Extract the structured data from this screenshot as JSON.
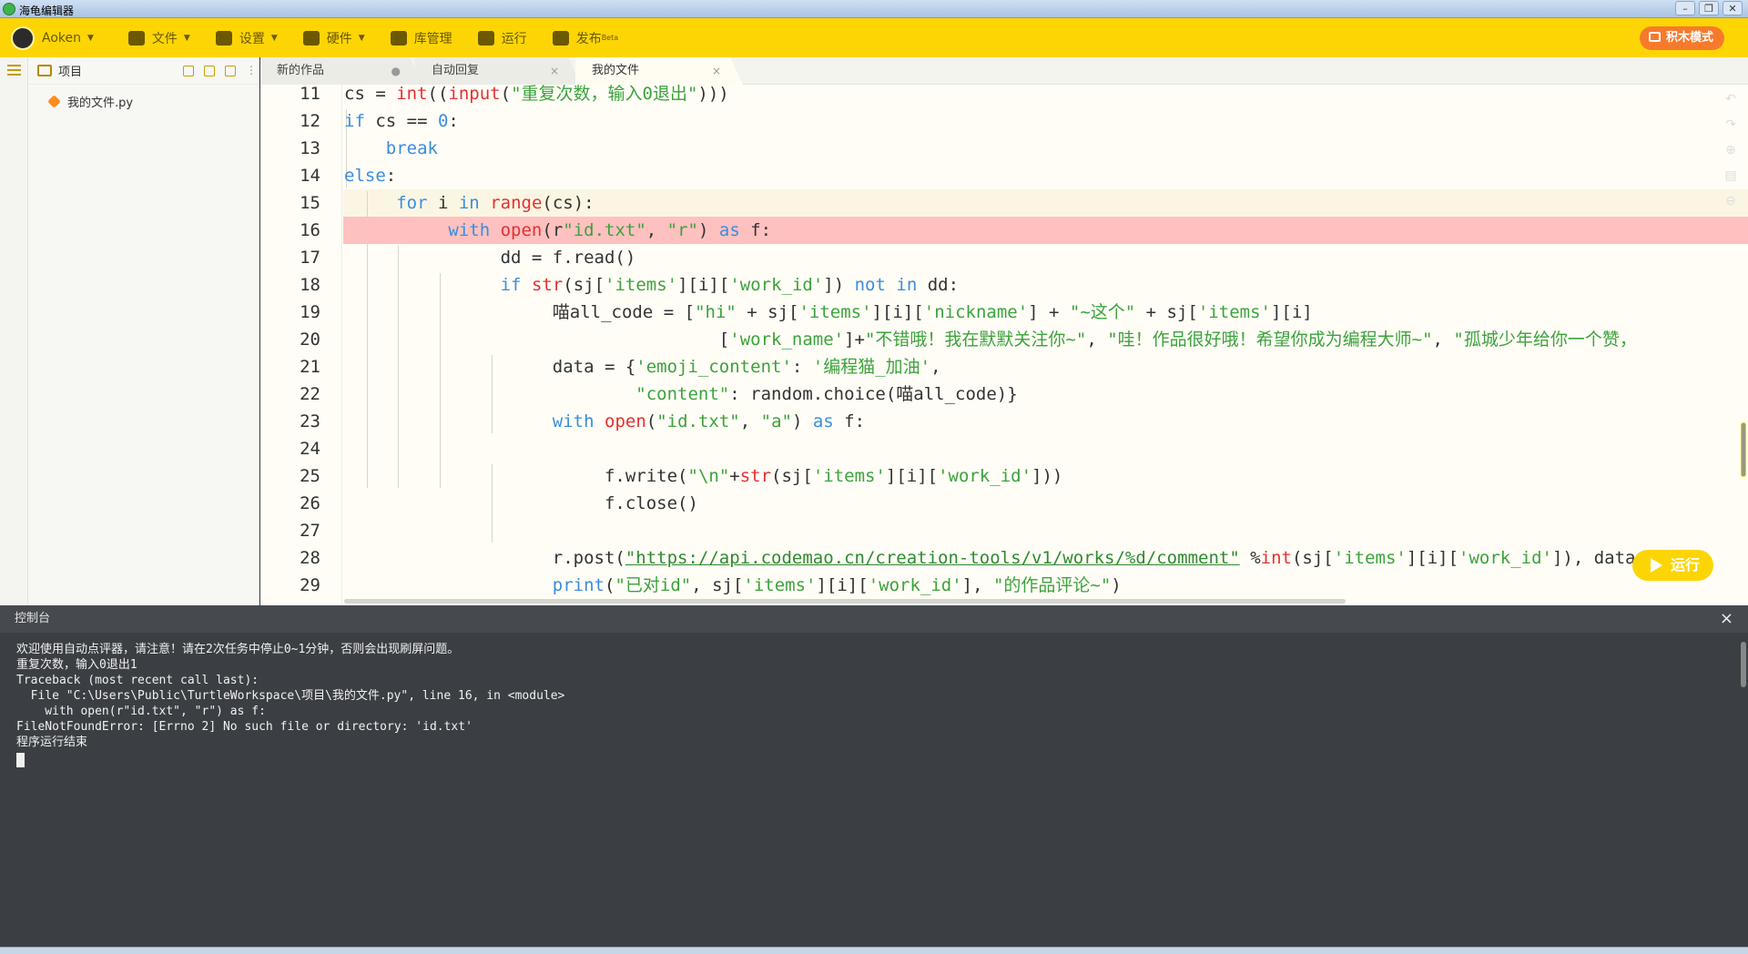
{
  "window": {
    "title": "海龟编辑器"
  },
  "menu": {
    "user": "Aoken",
    "items": [
      {
        "label": "文件",
        "caret": true
      },
      {
        "label": "设置",
        "caret": true
      },
      {
        "label": "硬件",
        "caret": true
      },
      {
        "label": "库管理",
        "caret": false
      },
      {
        "label": "运行",
        "caret": false
      },
      {
        "label": "发布",
        "caret": false
      }
    ],
    "publish_badge": "Beta",
    "block_mode": "积木模式"
  },
  "project": {
    "title": "项目",
    "files": [
      "我的文件.py"
    ]
  },
  "tabs": [
    {
      "label": "新的作品",
      "close": "●"
    },
    {
      "label": "自动回复",
      "close": "×"
    },
    {
      "label": "我的文件",
      "close": "×"
    }
  ],
  "editor": {
    "lines": [
      {
        "n": "11",
        "code": [
          [
            "cs = ",
            ""
          ],
          [
            "int",
            "fn"
          ],
          [
            "((",
            ""
          ],
          [
            "input",
            "fn"
          ],
          [
            "(",
            ""
          ],
          [
            "\"重复次数，输入0退出\"",
            "st"
          ],
          [
            ")))",
            ""
          ]
        ]
      },
      {
        "n": "12",
        "code": [
          [
            "if",
            "kw"
          ],
          [
            " cs == ",
            ""
          ],
          [
            "0",
            "nm"
          ],
          [
            ":",
            ""
          ]
        ]
      },
      {
        "n": "13",
        "code": [
          [
            "    ",
            ""
          ],
          [
            "break",
            "kw"
          ]
        ]
      },
      {
        "n": "14",
        "code": [
          [
            "else",
            "kw"
          ],
          [
            ":",
            ""
          ]
        ]
      },
      {
        "n": "15",
        "code": [
          [
            "     ",
            ""
          ],
          [
            "for",
            "kw"
          ],
          [
            " i ",
            ""
          ],
          [
            "in",
            "kw"
          ],
          [
            " ",
            ""
          ],
          [
            "range",
            "fn"
          ],
          [
            "(cs):",
            ""
          ]
        ]
      },
      {
        "n": "16",
        "code": [
          [
            "          ",
            ""
          ],
          [
            "with",
            "kw"
          ],
          [
            " ",
            ""
          ],
          [
            "open",
            "fn"
          ],
          [
            "(r",
            ""
          ],
          [
            "\"id.txt\"",
            "st"
          ],
          [
            ", ",
            ""
          ],
          [
            "\"r\"",
            "st"
          ],
          [
            ") ",
            ""
          ],
          [
            "as",
            "kw"
          ],
          [
            " f:",
            ""
          ]
        ]
      },
      {
        "n": "17",
        "code": [
          [
            "               dd = f.read()",
            ""
          ]
        ]
      },
      {
        "n": "18",
        "code": [
          [
            "               ",
            ""
          ],
          [
            "if",
            "kw"
          ],
          [
            " ",
            ""
          ],
          [
            "str",
            "fn"
          ],
          [
            "(sj[",
            ""
          ],
          [
            "'items'",
            "st"
          ],
          [
            "][i][",
            ""
          ],
          [
            "'work_id'",
            "st"
          ],
          [
            "]) ",
            ""
          ],
          [
            "not",
            "kw"
          ],
          [
            " ",
            ""
          ],
          [
            "in",
            "kw"
          ],
          [
            " dd:",
            ""
          ]
        ]
      },
      {
        "n": "19",
        "code": [
          [
            "                    喵all_code = [",
            ""
          ],
          [
            "\"hi\"",
            "st"
          ],
          [
            " + sj[",
            ""
          ],
          [
            "'items'",
            "st"
          ],
          [
            "][i][",
            ""
          ],
          [
            "'nickname'",
            "st"
          ],
          [
            "] + ",
            ""
          ],
          [
            "\"~这个\"",
            "st"
          ],
          [
            " + sj[",
            ""
          ],
          [
            "'items'",
            "st"
          ],
          [
            "][i]",
            ""
          ]
        ]
      },
      {
        "n": "20",
        "code": [
          [
            "                                    [",
            ""
          ],
          [
            "'work_name'",
            "st"
          ],
          [
            "]+",
            ""
          ],
          [
            "\"不错哦！我在默默关注你~\"",
            "st"
          ],
          [
            ", ",
            ""
          ],
          [
            "\"哇！作品很好哦！希望你成为编程大师~\"",
            "st"
          ],
          [
            ", ",
            ""
          ],
          [
            "\"孤城少年给你一个赞，",
            "st"
          ]
        ]
      },
      {
        "n": "21",
        "code": [
          [
            "                    data = {",
            ""
          ],
          [
            "'emoji_content'",
            "st"
          ],
          [
            ": ",
            ""
          ],
          [
            "'编程猫_加油'",
            "st"
          ],
          [
            ",",
            ""
          ]
        ]
      },
      {
        "n": "22",
        "code": [
          [
            "                            ",
            ""
          ],
          [
            "\"content\"",
            "st"
          ],
          [
            ": random.choice(喵all_code)}",
            ""
          ]
        ]
      },
      {
        "n": "23",
        "code": [
          [
            "                    ",
            ""
          ],
          [
            "with",
            "kw"
          ],
          [
            " ",
            ""
          ],
          [
            "open",
            "fn"
          ],
          [
            "(",
            ""
          ],
          [
            "\"id.txt\"",
            "st"
          ],
          [
            ", ",
            ""
          ],
          [
            "\"a\"",
            "st"
          ],
          [
            ") ",
            ""
          ],
          [
            "as",
            "kw"
          ],
          [
            " f:",
            ""
          ]
        ]
      },
      {
        "n": "24",
        "code": [
          [
            "",
            ""
          ]
        ]
      },
      {
        "n": "25",
        "code": [
          [
            "                         f.write(",
            ""
          ],
          [
            "\"\\n\"",
            "st"
          ],
          [
            "+",
            ""
          ],
          [
            "str",
            "fn"
          ],
          [
            "(sj[",
            ""
          ],
          [
            "'items'",
            "st"
          ],
          [
            "][i][",
            ""
          ],
          [
            "'work_id'",
            "st"
          ],
          [
            "]))",
            ""
          ]
        ]
      },
      {
        "n": "26",
        "code": [
          [
            "                         f.close()",
            ""
          ]
        ]
      },
      {
        "n": "27",
        "code": [
          [
            "",
            ""
          ]
        ]
      },
      {
        "n": "28",
        "code": [
          [
            "                    r.post(",
            ""
          ],
          [
            "\"https://api.codemao.cn/creation-tools/v1/works/%d/comment\"",
            "ur"
          ],
          [
            " %",
            ""
          ],
          [
            "int",
            "fn"
          ],
          [
            "(sj[",
            ""
          ],
          [
            "'items'",
            "st"
          ],
          [
            "][i][",
            ""
          ],
          [
            "'work_id'",
            "st"
          ],
          [
            "]), data=dat",
            ""
          ]
        ]
      },
      {
        "n": "29",
        "code": [
          [
            "                    ",
            ""
          ],
          [
            "print",
            "kw"
          ],
          [
            "(",
            ""
          ],
          [
            "\"已对id\"",
            "st"
          ],
          [
            ", sj[",
            ""
          ],
          [
            "'items'",
            "st"
          ],
          [
            "][i][",
            ""
          ],
          [
            "'work_id'",
            "st"
          ],
          [
            "], ",
            ""
          ],
          [
            "\"的作品评论~\"",
            "st"
          ],
          [
            ")",
            ""
          ]
        ]
      }
    ],
    "run_button": "运行"
  },
  "console": {
    "title": "控制台",
    "close": "×",
    "lines": [
      "欢迎使用自动点评器，请注意！请在2次任务中停止0~1分钟，否则会出现刷屏问题。",
      "重复次数，输入0退出1",
      "Traceback (most recent call last):",
      "  File \"C:\\Users\\Public\\TurtleWorkspace\\项目\\我的文件.py\", line 16, in <module>",
      "    with open(r\"id.txt\", \"r\") as f:",
      "FileNotFoundError: [Errno 2] No such file or directory: 'id.txt'",
      "程序运行结束"
    ]
  },
  "colors": {
    "accent": "#fdd504",
    "block_mode": "#f77a2c",
    "error_line": "#ffc0c0",
    "current_line": "#fbf6e3"
  }
}
